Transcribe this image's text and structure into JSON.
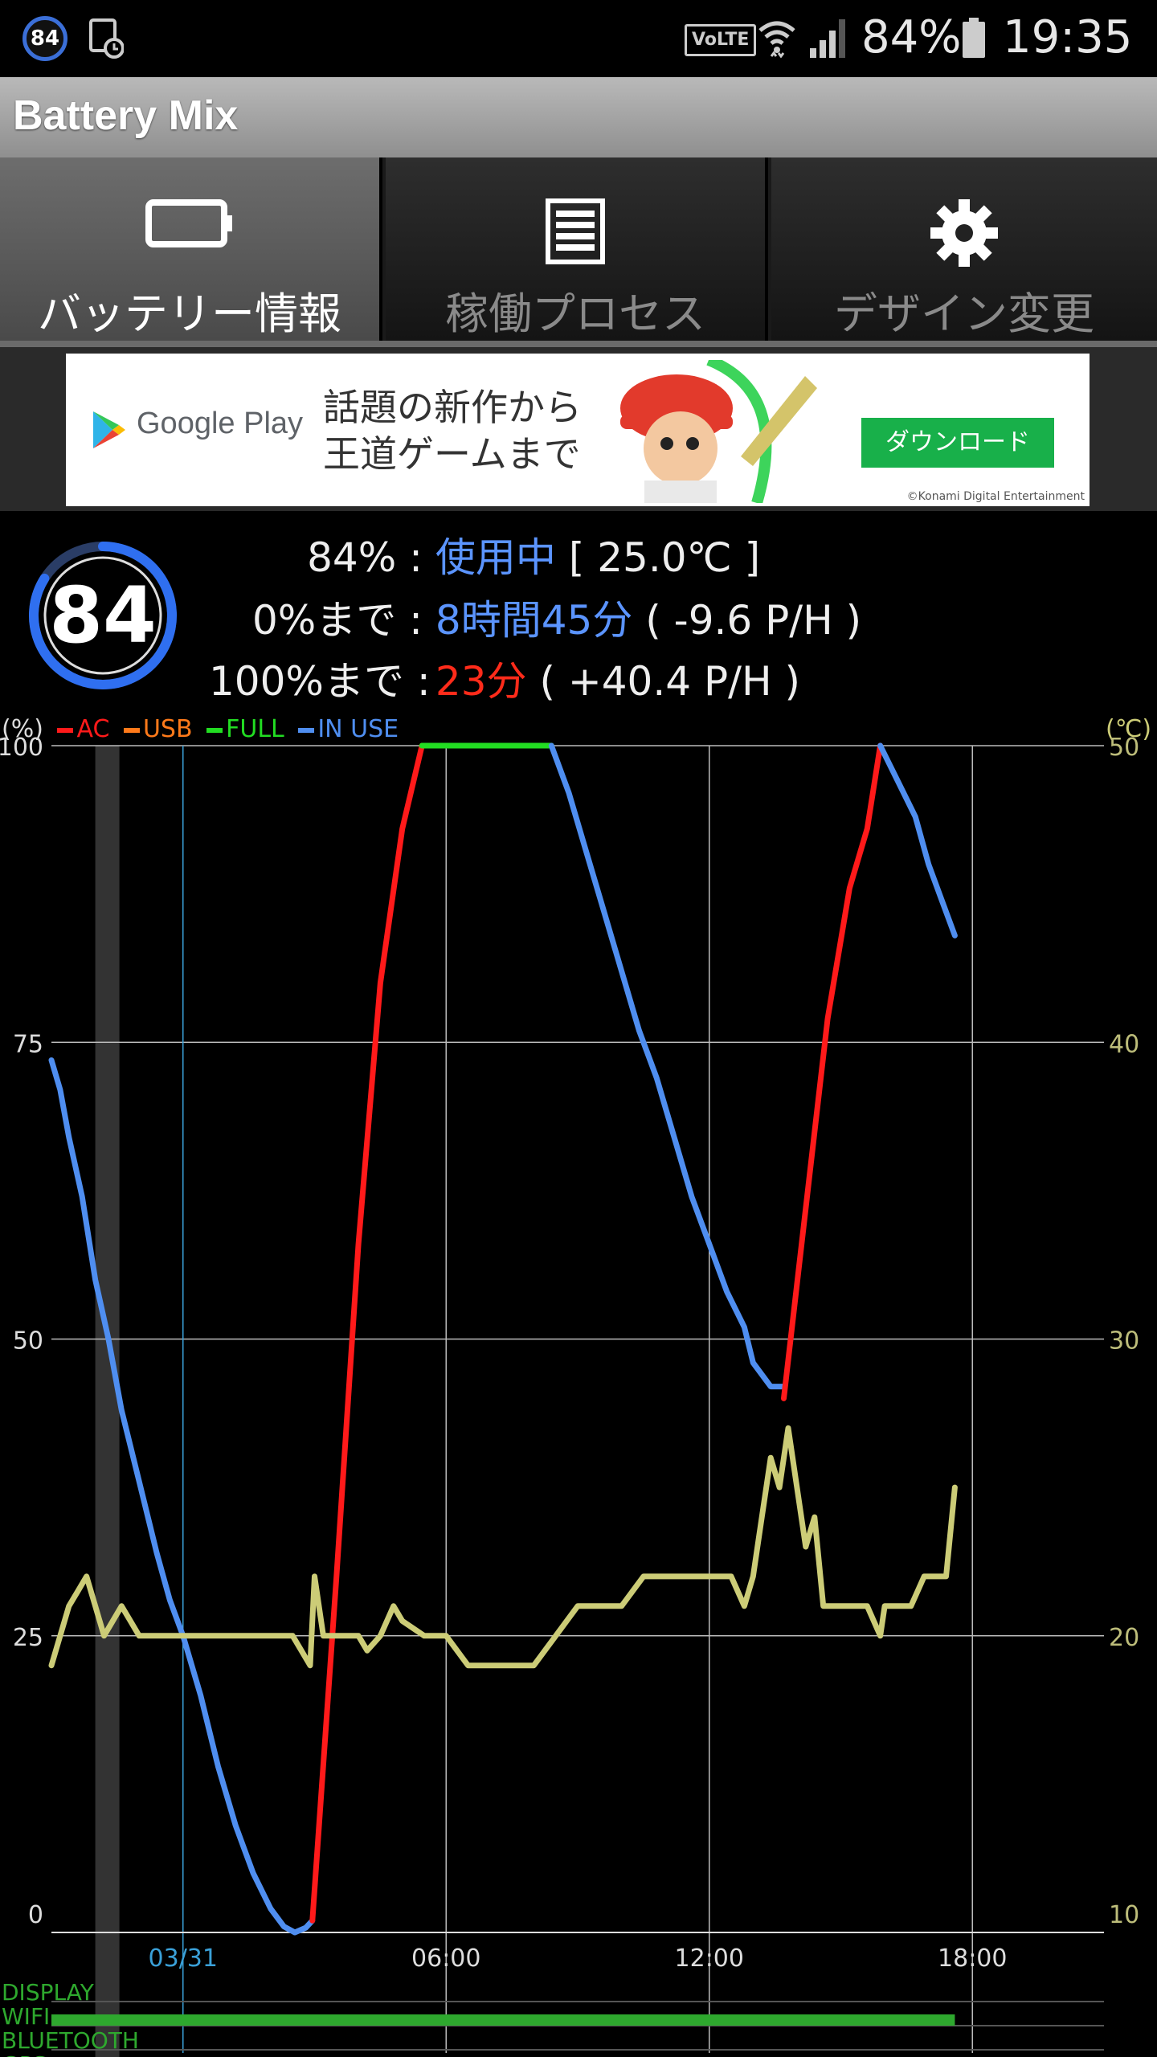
{
  "status_bar": {
    "battery_badge": "84",
    "volte": "VoLTE",
    "battery_percent": "84%",
    "time": "19:35"
  },
  "app": {
    "title": "Battery Mix"
  },
  "tabs": [
    {
      "label": "バッテリー情報",
      "icon": "battery-icon",
      "active": true
    },
    {
      "label": "稼働プロセス",
      "icon": "list-icon",
      "active": false
    },
    {
      "label": "デザイン変更",
      "icon": "gear-icon",
      "active": false
    }
  ],
  "ad": {
    "store": "Google Play",
    "line1": "話題の新作から",
    "line2": "王道ゲームまで",
    "button": "ダウンロード",
    "copyright": "©Konami Digital Entertainment"
  },
  "info": {
    "gauge_value": "84",
    "row1": {
      "label": "84% :",
      "state": "使用中",
      "extra": "[ 25.0℃ ]"
    },
    "row2": {
      "label": "0%まで :",
      "time": "8時間45分",
      "rate": "( -9.6 P/H )"
    },
    "row3": {
      "label": "100%まで :",
      "time": "23分",
      "rate": "( +40.4 P/H )"
    }
  },
  "colors": {
    "ac": "#ff1a1a",
    "usb": "#ff7a1a",
    "full": "#22dd22",
    "in_use": "#4f8ef0",
    "temperature": "#cccc77",
    "accent_blue": "#5b94ff"
  },
  "chart_data": {
    "type": "line",
    "left_axis_unit": "(%)",
    "right_axis_unit": "(℃)",
    "legend": [
      "AC",
      "USB",
      "FULL",
      "IN USE"
    ],
    "y_ticks": [
      "100",
      "75",
      "50",
      "25",
      "0"
    ],
    "y2_ticks": [
      "50",
      "40",
      "30",
      "20",
      "10"
    ],
    "ylim": [
      0,
      100
    ],
    "y2lim": [
      10,
      50
    ],
    "x_ticks": [
      {
        "label": "03/31",
        "hour": 0,
        "highlight": true
      },
      {
        "label": "06:00",
        "hour": 6,
        "highlight": false
      },
      {
        "label": "12:00",
        "hour": 12,
        "highlight": false
      },
      {
        "label": "18:00",
        "hour": 18,
        "highlight": false
      }
    ],
    "xlim_hours": [
      -3,
      21
    ],
    "off_period_hours": [
      -2.0,
      -1.45
    ],
    "series": [
      {
        "name": "IN USE",
        "kind": "battery",
        "color": "#4f8ef0",
        "points": [
          [
            -3,
            73.5
          ],
          [
            -2.8,
            71
          ],
          [
            -2.6,
            67
          ],
          [
            -2.3,
            62
          ],
          [
            -2,
            55
          ],
          [
            -1.7,
            50
          ],
          [
            -1.4,
            44
          ],
          [
            -1,
            38
          ],
          [
            -0.6,
            32
          ],
          [
            -0.3,
            28
          ],
          [
            0,
            25
          ],
          [
            0.4,
            20
          ],
          [
            0.8,
            14
          ],
          [
            1.2,
            9
          ],
          [
            1.6,
            5
          ],
          [
            2,
            2
          ],
          [
            2.3,
            0.5
          ],
          [
            2.55,
            0
          ],
          [
            2.8,
            0.4
          ],
          [
            2.95,
            1
          ]
        ]
      },
      {
        "name": "AC",
        "kind": "battery",
        "color": "#ff1a1a",
        "points": [
          [
            2.95,
            1
          ],
          [
            3.5,
            30
          ],
          [
            4,
            58
          ],
          [
            4.5,
            80
          ],
          [
            5,
            93
          ],
          [
            5.45,
            100
          ]
        ]
      },
      {
        "name": "FULL",
        "kind": "battery",
        "color": "#22dd22",
        "points": [
          [
            5.45,
            100
          ],
          [
            8.4,
            100
          ]
        ]
      },
      {
        "name": "IN USE",
        "kind": "battery",
        "color": "#4f8ef0",
        "points": [
          [
            8.4,
            100
          ],
          [
            8.8,
            96
          ],
          [
            9.2,
            91
          ],
          [
            9.6,
            86
          ],
          [
            10,
            81
          ],
          [
            10.4,
            76
          ],
          [
            10.8,
            72
          ],
          [
            11.2,
            67
          ],
          [
            11.6,
            62
          ],
          [
            12,
            58
          ],
          [
            12.4,
            54
          ],
          [
            12.8,
            51
          ],
          [
            13,
            48
          ],
          [
            13.4,
            46
          ],
          [
            13.7,
            46
          ]
        ]
      },
      {
        "name": "AC",
        "kind": "battery",
        "color": "#ff1a1a",
        "points": [
          [
            13.7,
            45
          ],
          [
            14.2,
            61
          ],
          [
            14.7,
            77
          ],
          [
            15.2,
            88
          ],
          [
            15.6,
            93
          ],
          [
            15.9,
            100
          ]
        ]
      },
      {
        "name": "IN USE",
        "kind": "battery",
        "color": "#4f8ef0",
        "points": [
          [
            15.9,
            100
          ],
          [
            16.3,
            97
          ],
          [
            16.7,
            94
          ],
          [
            17,
            90
          ],
          [
            17.3,
            87
          ],
          [
            17.6,
            84
          ]
        ]
      },
      {
        "name": "Temperature",
        "kind": "temperature",
        "color": "#cccc77",
        "points": [
          [
            -3,
            19
          ],
          [
            -2.8,
            20
          ],
          [
            -2.6,
            21
          ],
          [
            -2.4,
            21.5
          ],
          [
            -2.2,
            22
          ],
          [
            -2,
            21
          ],
          [
            -1.8,
            20
          ],
          [
            -1.6,
            20.5
          ],
          [
            -1.4,
            21
          ],
          [
            -1.2,
            20.5
          ],
          [
            -1,
            20
          ],
          [
            -0.5,
            20
          ],
          [
            0,
            20
          ],
          [
            0.5,
            20
          ],
          [
            1,
            20
          ],
          [
            1.5,
            20
          ],
          [
            2,
            20
          ],
          [
            2.5,
            20
          ],
          [
            2.9,
            19
          ],
          [
            3,
            22
          ],
          [
            3.2,
            20
          ],
          [
            3.5,
            20
          ],
          [
            4,
            20
          ],
          [
            4.2,
            19.5
          ],
          [
            4.5,
            20
          ],
          [
            4.8,
            21
          ],
          [
            5,
            20.5
          ],
          [
            5.5,
            20
          ],
          [
            6,
            20
          ],
          [
            6.5,
            19
          ],
          [
            7,
            19
          ],
          [
            7.5,
            19
          ],
          [
            8,
            19
          ],
          [
            8.5,
            20
          ],
          [
            9,
            21
          ],
          [
            9.5,
            21
          ],
          [
            10,
            21
          ],
          [
            10.5,
            22
          ],
          [
            11,
            22
          ],
          [
            11.5,
            22
          ],
          [
            12,
            22
          ],
          [
            12.5,
            22
          ],
          [
            12.8,
            21
          ],
          [
            13,
            22
          ],
          [
            13.2,
            24
          ],
          [
            13.4,
            26
          ],
          [
            13.6,
            25
          ],
          [
            13.8,
            27
          ],
          [
            14,
            25
          ],
          [
            14.2,
            23
          ],
          [
            14.4,
            24
          ],
          [
            14.6,
            21
          ],
          [
            14.8,
            21
          ],
          [
            15,
            21
          ],
          [
            15.3,
            21
          ],
          [
            15.6,
            21
          ],
          [
            15.9,
            20
          ],
          [
            16,
            21
          ],
          [
            16.3,
            21
          ],
          [
            16.6,
            21
          ],
          [
            16.9,
            22
          ],
          [
            17.2,
            22
          ],
          [
            17.4,
            22
          ],
          [
            17.6,
            25
          ]
        ]
      }
    ],
    "activity_rows": [
      {
        "label": "DISPLAY",
        "color": "#2ea82e",
        "bar": false
      },
      {
        "label": "WIFI",
        "color": "#2ea82e",
        "bar": true
      },
      {
        "label": "BLUETOOTH",
        "color": "#2ea82e",
        "bar": false
      },
      {
        "label": "GPS",
        "color": "#2ea82e",
        "bar": true
      }
    ]
  }
}
